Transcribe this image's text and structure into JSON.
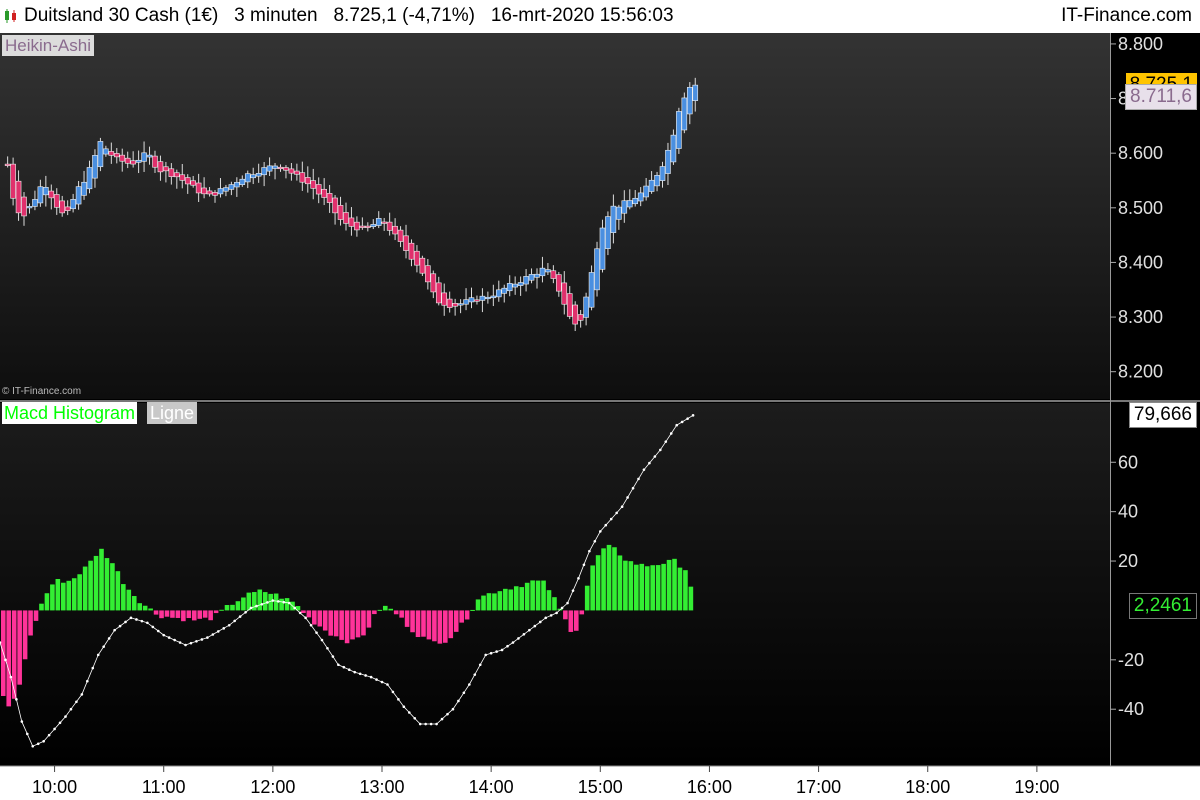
{
  "header": {
    "instrument": "Duitsland 30 Cash (1€)",
    "timeframe": "3 minuten",
    "price_change": "8.725,1 (-4,71%)",
    "datetime": "16-mrt-2020 15:56:03",
    "brand": "IT-Finance.com"
  },
  "price_panel": {
    "label": "Heikin-Ashi",
    "copyright": "© IT-Finance.com",
    "last_price_badge": "8.725,1",
    "ha_price_badge": "8.711,6"
  },
  "macd_panel": {
    "label": "Macd Histogram",
    "line_label": "Ligne",
    "line_value_badge": "79,666",
    "hist_value_badge": "2,2461"
  },
  "colors": {
    "background": "#000000",
    "up_candle": "#4a8fe0",
    "down_candle": "#e0306c",
    "hist_positive": "#33ee33",
    "hist_negative": "#ff3399",
    "line": "#ffffff",
    "last_price_badge_bg": "#ffc400",
    "ha_price_badge_bg": "#e8e0ea",
    "ha_price_badge_text": "#8a6b8e"
  },
  "chart_data": [
    {
      "type": "candlestick",
      "title": "Heikin-Ashi",
      "x_ticks": [
        "10:00",
        "11:00",
        "12:00",
        "13:00",
        "14:00",
        "15:00",
        "16:00",
        "17:00",
        "18:00",
        "19:00"
      ],
      "y_ticks": [
        "8.200",
        "8.300",
        "8.400",
        "8.500",
        "8.600",
        "8.700",
        "8.800"
      ],
      "y_tick_values": [
        8200,
        8300,
        8400,
        8500,
        8600,
        8700,
        8800
      ],
      "ylim": [
        8150,
        8820
      ],
      "x_axis_hours": [
        9.5,
        19.67
      ],
      "bar_minutes": 3,
      "ha_close_profile": [
        [
          9.57,
          8580
        ],
        [
          9.62,
          8520
        ],
        [
          9.7,
          8480
        ],
        [
          9.8,
          8510
        ],
        [
          9.9,
          8550
        ],
        [
          10.0,
          8510
        ],
        [
          10.1,
          8480
        ],
        [
          10.2,
          8530
        ],
        [
          10.3,
          8560
        ],
        [
          10.42,
          8620
        ],
        [
          10.55,
          8590
        ],
        [
          10.7,
          8580
        ],
        [
          10.85,
          8600
        ],
        [
          10.95,
          8570
        ],
        [
          11.1,
          8560
        ],
        [
          11.25,
          8540
        ],
        [
          11.4,
          8520
        ],
        [
          11.5,
          8530
        ],
        [
          11.6,
          8540
        ],
        [
          11.75,
          8560
        ],
        [
          11.9,
          8570
        ],
        [
          12.05,
          8580
        ],
        [
          12.2,
          8560
        ],
        [
          12.35,
          8540
        ],
        [
          12.5,
          8510
        ],
        [
          12.65,
          8470
        ],
        [
          12.85,
          8460
        ],
        [
          13.0,
          8480
        ],
        [
          13.15,
          8440
        ],
        [
          13.35,
          8390
        ],
        [
          13.5,
          8330
        ],
        [
          13.65,
          8320
        ],
        [
          13.8,
          8330
        ],
        [
          14.0,
          8340
        ],
        [
          14.2,
          8360
        ],
        [
          14.4,
          8380
        ],
        [
          14.5,
          8390
        ],
        [
          14.62,
          8350
        ],
        [
          14.72,
          8300
        ],
        [
          14.8,
          8280
        ],
        [
          14.9,
          8360
        ],
        [
          15.0,
          8460
        ],
        [
          15.1,
          8500
        ],
        [
          15.25,
          8510
        ],
        [
          15.4,
          8530
        ],
        [
          15.55,
          8570
        ],
        [
          15.65,
          8620
        ],
        [
          15.72,
          8680
        ],
        [
          15.8,
          8720
        ],
        [
          15.87,
          8725
        ]
      ]
    },
    {
      "type": "bar+line",
      "title": "Macd Histogram",
      "series": [
        {
          "name": "Macd Histogram"
        },
        {
          "name": "Ligne"
        }
      ],
      "y_ticks": [
        "-40",
        "-20",
        "20",
        "40",
        "60"
      ],
      "y_tick_values": [
        -40,
        -20,
        20,
        40,
        60
      ],
      "ylim": [
        -63,
        84
      ],
      "histogram_profile": [
        [
          9.53,
          -35
        ],
        [
          9.6,
          -40
        ],
        [
          9.68,
          -30
        ],
        [
          9.75,
          -15
        ],
        [
          9.82,
          -5
        ],
        [
          9.9,
          5
        ],
        [
          10.0,
          12
        ],
        [
          10.15,
          12
        ],
        [
          10.3,
          18
        ],
        [
          10.42,
          25
        ],
        [
          10.52,
          20
        ],
        [
          10.65,
          10
        ],
        [
          10.8,
          3
        ],
        [
          10.95,
          -2
        ],
        [
          11.1,
          -3
        ],
        [
          11.3,
          -4
        ],
        [
          11.45,
          -3
        ],
        [
          11.6,
          2
        ],
        [
          11.75,
          6
        ],
        [
          11.9,
          8
        ],
        [
          12.05,
          6
        ],
        [
          12.2,
          3
        ],
        [
          12.35,
          -4
        ],
        [
          12.55,
          -10
        ],
        [
          12.72,
          -13
        ],
        [
          12.85,
          -9
        ],
        [
          12.92,
          -3
        ],
        [
          13.0,
          2
        ],
        [
          13.1,
          0
        ],
        [
          13.3,
          -9
        ],
        [
          13.45,
          -13
        ],
        [
          13.6,
          -12
        ],
        [
          13.75,
          -5
        ],
        [
          13.88,
          5
        ],
        [
          14.05,
          8
        ],
        [
          14.25,
          10
        ],
        [
          14.4,
          12
        ],
        [
          14.5,
          11
        ],
        [
          14.6,
          3
        ],
        [
          14.68,
          -4
        ],
        [
          14.76,
          -10
        ],
        [
          14.84,
          0
        ],
        [
          14.9,
          15
        ],
        [
          15.0,
          24
        ],
        [
          15.1,
          26
        ],
        [
          15.25,
          20
        ],
        [
          15.4,
          18
        ],
        [
          15.55,
          19
        ],
        [
          15.68,
          20
        ],
        [
          15.8,
          16
        ],
        [
          15.87,
          2
        ]
      ],
      "line_profile": [
        [
          9.5,
          -13
        ],
        [
          9.6,
          -27
        ],
        [
          9.7,
          -45
        ],
        [
          9.8,
          -55
        ],
        [
          9.9,
          -53
        ],
        [
          10.0,
          -48
        ],
        [
          10.1,
          -43
        ],
        [
          10.25,
          -34
        ],
        [
          10.4,
          -18
        ],
        [
          10.55,
          -8
        ],
        [
          10.7,
          -3
        ],
        [
          10.85,
          -5
        ],
        [
          11.0,
          -10
        ],
        [
          11.2,
          -14
        ],
        [
          11.4,
          -11
        ],
        [
          11.6,
          -6
        ],
        [
          11.8,
          1
        ],
        [
          12.0,
          4
        ],
        [
          12.15,
          3
        ],
        [
          12.3,
          -3
        ],
        [
          12.45,
          -12
        ],
        [
          12.6,
          -22
        ],
        [
          12.75,
          -25
        ],
        [
          12.9,
          -27
        ],
        [
          13.05,
          -30
        ],
        [
          13.2,
          -39
        ],
        [
          13.35,
          -46
        ],
        [
          13.5,
          -46
        ],
        [
          13.65,
          -40
        ],
        [
          13.8,
          -30
        ],
        [
          13.95,
          -18
        ],
        [
          14.1,
          -16
        ],
        [
          14.2,
          -13
        ],
        [
          14.35,
          -8
        ],
        [
          14.5,
          -3
        ],
        [
          14.6,
          -1
        ],
        [
          14.7,
          3
        ],
        [
          14.8,
          13
        ],
        [
          14.9,
          24
        ],
        [
          15.0,
          32
        ],
        [
          15.2,
          42
        ],
        [
          15.4,
          57
        ],
        [
          15.55,
          65
        ],
        [
          15.7,
          75
        ],
        [
          15.85,
          79
        ]
      ]
    }
  ]
}
